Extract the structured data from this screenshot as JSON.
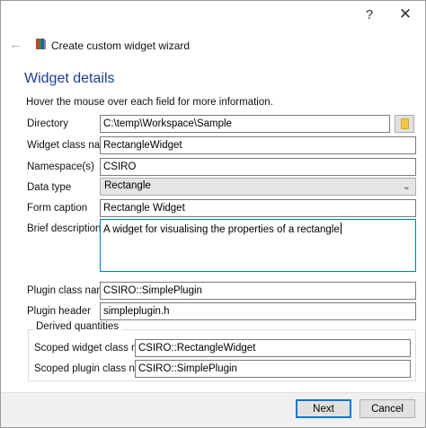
{
  "titlebar": {
    "help_glyph": "?",
    "close_glyph": "✕"
  },
  "header": {
    "back_glyph": "←",
    "title": "Create custom widget wizard"
  },
  "page": {
    "title": "Widget details",
    "hint": "Hover the mouse over each field for more information."
  },
  "fields": {
    "directory": {
      "label": "Directory",
      "value": "C:\\temp\\Workspace\\Sample"
    },
    "widget_class_name": {
      "label": "Widget class name",
      "value": "RectangleWidget"
    },
    "namespace": {
      "label": "Namespace(s)",
      "value": "CSIRO"
    },
    "data_type": {
      "label": "Data type",
      "value": "Rectangle"
    },
    "form_caption": {
      "label": "Form caption",
      "value": "Rectangle Widget"
    },
    "brief_description": {
      "label": "Brief description",
      "value": "A widget for visualising the properties of a rectangle"
    },
    "plugin_class_name": {
      "label": "Plugin class name",
      "value": "CSIRO::SimplePlugin"
    },
    "plugin_header": {
      "label": "Plugin header",
      "value": "simpleplugin.h"
    }
  },
  "derived": {
    "title": "Derived quantities",
    "scoped_widget_class_name": {
      "label": "Scoped widget class name",
      "value": "CSIRO::RectangleWidget"
    },
    "scoped_plugin_class_name": {
      "label": "Scoped plugin class name",
      "value": "CSIRO::SimplePlugin"
    }
  },
  "buttons": {
    "next": "Next",
    "cancel": "Cancel"
  },
  "icons": {
    "folder": "folder-icon",
    "wizard": "wizard-icon",
    "dropdown": "chevron-down-icon",
    "back": "back-arrow-icon"
  },
  "colors": {
    "title_blue": "#1c3f94",
    "focus_blue": "#0078d7",
    "footer_bg": "#f0f0f0",
    "folder_yellow": "#f1c84b"
  }
}
